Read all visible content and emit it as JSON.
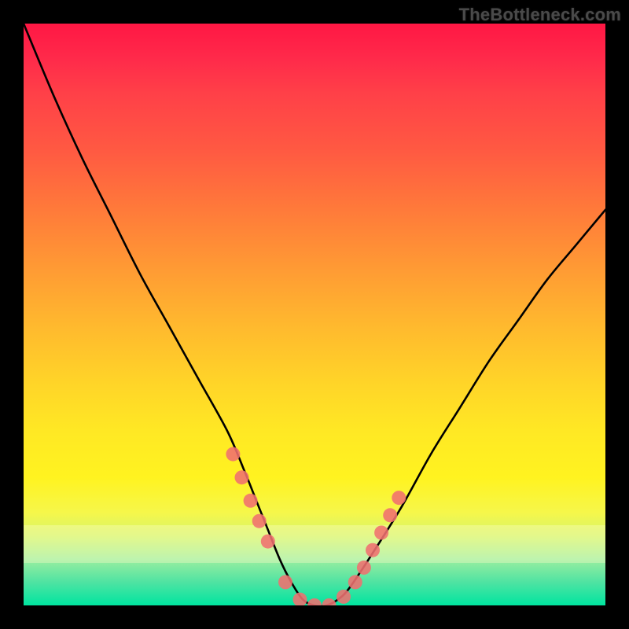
{
  "watermark": "TheBottleneck.com",
  "chart_data": {
    "type": "line",
    "title": "",
    "xlabel": "",
    "ylabel": "",
    "x_range": [
      0,
      100
    ],
    "y_range": [
      0,
      100
    ],
    "series": [
      {
        "name": "bottleneck-curve",
        "x": [
          0,
          5,
          10,
          15,
          20,
          25,
          30,
          35,
          38,
          40,
          42,
          44,
          46,
          48,
          50,
          52,
          54,
          56,
          60,
          65,
          70,
          75,
          80,
          85,
          90,
          95,
          100
        ],
        "values": [
          100,
          88,
          77,
          67,
          57,
          48,
          39,
          30,
          23,
          18,
          13,
          8,
          4,
          1,
          0,
          0,
          1,
          3,
          9,
          17,
          26,
          34,
          42,
          49,
          56,
          62,
          68
        ]
      }
    ],
    "markers": {
      "name": "highlight-points",
      "color": "#f07070",
      "radius_px": 9,
      "x": [
        36,
        37.5,
        39,
        40.5,
        42,
        45,
        47.5,
        50,
        52.5,
        55,
        57,
        58.5,
        60,
        61.5,
        63,
        64.5
      ],
      "values": [
        26,
        22,
        18,
        14.5,
        11,
        4,
        1,
        0,
        0,
        1.5,
        4,
        6.5,
        9.5,
        12.5,
        15.5,
        18.5
      ]
    },
    "gradient_stops": [
      {
        "pos": 0,
        "color": "#ff1744"
      },
      {
        "pos": 50,
        "color": "#ffd528"
      },
      {
        "pos": 80,
        "color": "#fff320"
      },
      {
        "pos": 100,
        "color": "#00e5a0"
      }
    ]
  }
}
